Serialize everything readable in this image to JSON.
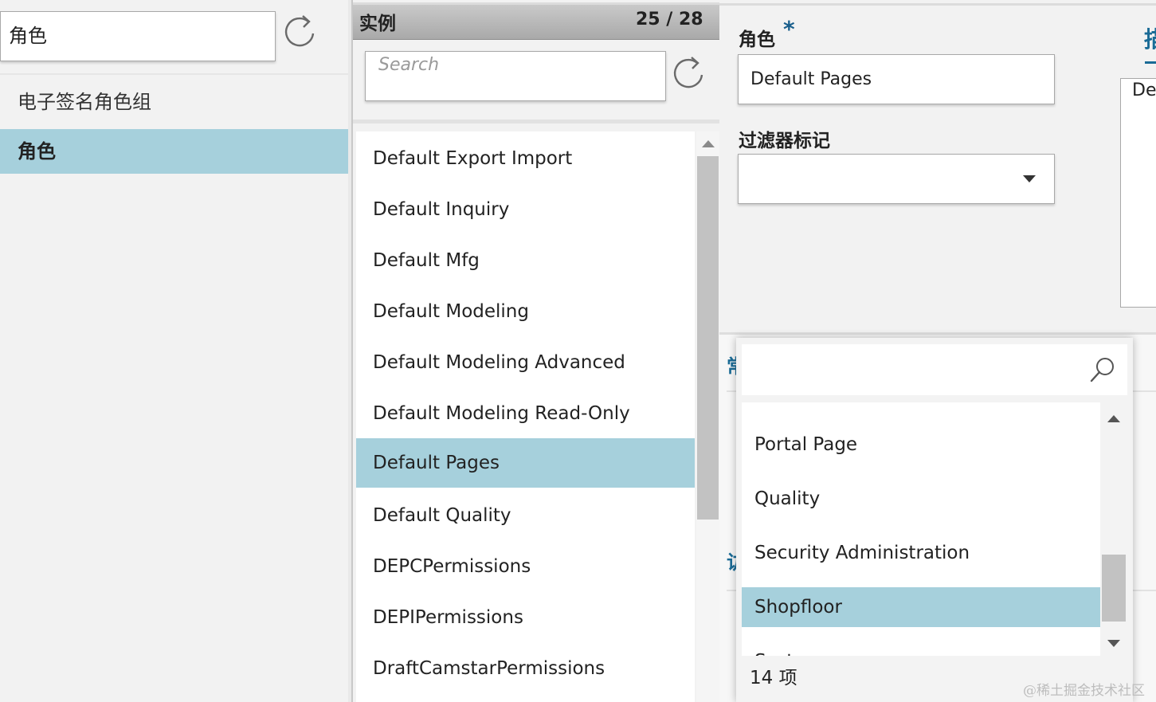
{
  "left_panel": {
    "search_value": "角色",
    "items": [
      {
        "label": "电子签名角色组",
        "selected": false
      },
      {
        "label": "角色",
        "selected": true
      }
    ]
  },
  "instances": {
    "header_title": "实例",
    "count": "25 / 28",
    "search_placeholder": "Search",
    "items": [
      {
        "label": "Default Export Import",
        "selected": false
      },
      {
        "label": "Default Inquiry",
        "selected": false
      },
      {
        "label": "Default Mfg",
        "selected": false
      },
      {
        "label": "Default Modeling",
        "selected": false
      },
      {
        "label": "Default Modeling Advanced",
        "selected": false
      },
      {
        "label": "Default Modeling Read-Only",
        "selected": false
      },
      {
        "label": "Default Pages",
        "selected": true
      },
      {
        "label": "Default Quality",
        "selected": false
      },
      {
        "label": "DEPCPermissions",
        "selected": false
      },
      {
        "label": "DEPIPermissions",
        "selected": false
      },
      {
        "label": "DraftCamstarPermissions",
        "selected": false
      }
    ]
  },
  "form": {
    "role_label": "角色",
    "required_mark": "*",
    "role_value": "Default Pages",
    "filter_label": "过滤器标记",
    "filter_value": "",
    "tab_glyph_partial": "描",
    "description_partial": "De",
    "peek_label_a": "常",
    "peek_label_b": "访"
  },
  "dropdown": {
    "search_value": "",
    "items": [
      {
        "label": "Portal Page",
        "selected": false
      },
      {
        "label": "Quality",
        "selected": false
      },
      {
        "label": "Security Administration",
        "selected": false
      },
      {
        "label": "Shopfloor",
        "selected": true
      },
      {
        "label": "Syst",
        "selected": false
      }
    ],
    "count_text": "14 项"
  },
  "watermark": "@稀土掘金技术社区",
  "colors": {
    "selection": "#a6d0dc",
    "accent": "#1a6b96",
    "scroll_thumb": "#c2c2c2"
  },
  "icons": {
    "refresh": "refresh-icon",
    "search": "magnifier-icon",
    "dropdown_caret": "caret-down-icon"
  }
}
